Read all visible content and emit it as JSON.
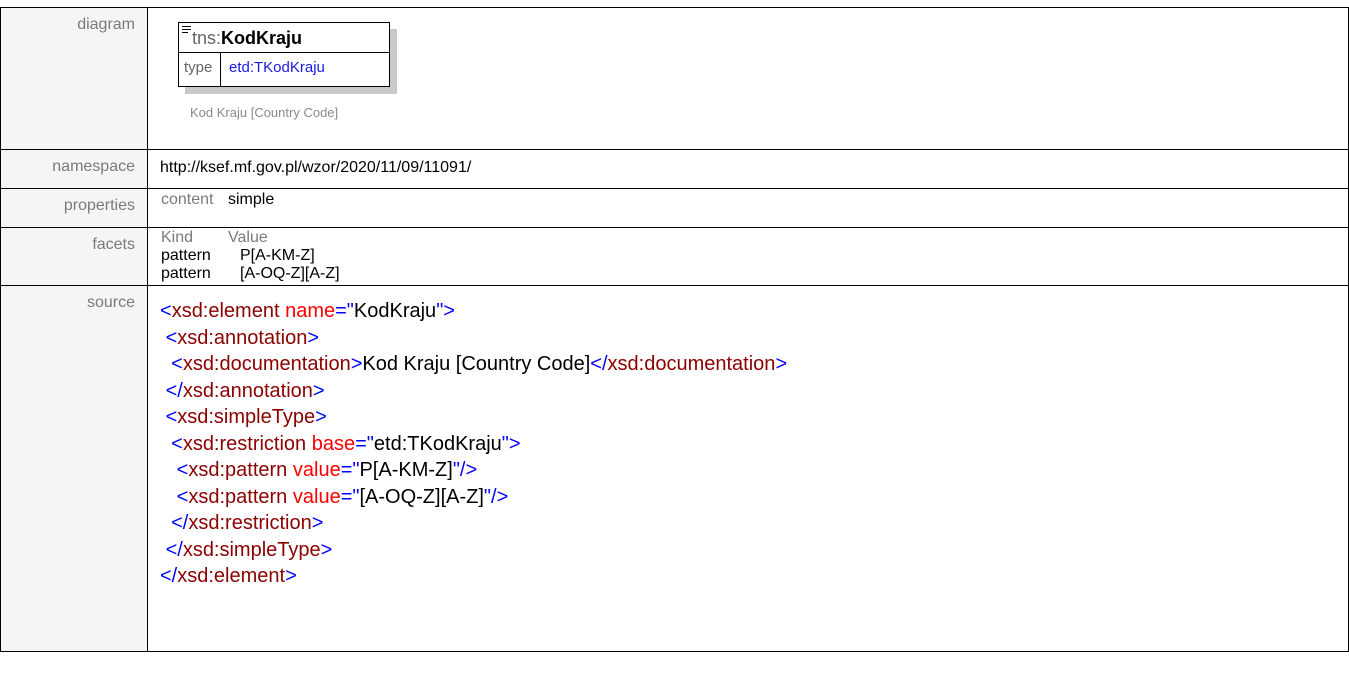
{
  "rows": {
    "diagram_label": "diagram",
    "namespace_label": "namespace",
    "properties_label": "properties",
    "facets_label": "facets",
    "source_label": "source"
  },
  "diagram": {
    "prefix": "tns:",
    "name": "KodKraju",
    "type_key": "type",
    "type_value": "etd:TKodKraju",
    "documentation": "Kod Kraju [Country Code]"
  },
  "namespace": {
    "value": "http://ksef.mf.gov.pl/wzor/2020/11/09/11091/"
  },
  "properties": {
    "key": "content",
    "value": "simple"
  },
  "facets": {
    "headers": [
      "Kind",
      "Value"
    ],
    "rows": [
      {
        "kind": "pattern",
        "value": "P[A-KM-Z]"
      },
      {
        "kind": "pattern",
        "value": "[A-OQ-Z][A-Z]"
      }
    ]
  },
  "source": {
    "element_tag": "xsd:element",
    "attr_name": "name",
    "element_name": "KodKraju",
    "annotation_tag": "xsd:annotation",
    "documentation_tag": "xsd:documentation",
    "documentation_text": "Kod Kraju [Country Code]",
    "simpletype_tag": "xsd:simpleType",
    "restriction_tag": "xsd:restriction",
    "attr_base": "base",
    "base_value": "etd:TKodKraju",
    "pattern_tag": "xsd:pattern",
    "attr_value": "value",
    "pattern1": "P[A-KM-Z]",
    "pattern2": "[A-OQ-Z][A-Z]"
  },
  "colors": {
    "tag": "#8b0000",
    "bracket": "#0000ff",
    "attribute": "#ff0000",
    "type_link": "#1a1ae6",
    "label_bg": "#f5f5f5"
  },
  "icons": {
    "element_marker": "lines-icon"
  }
}
